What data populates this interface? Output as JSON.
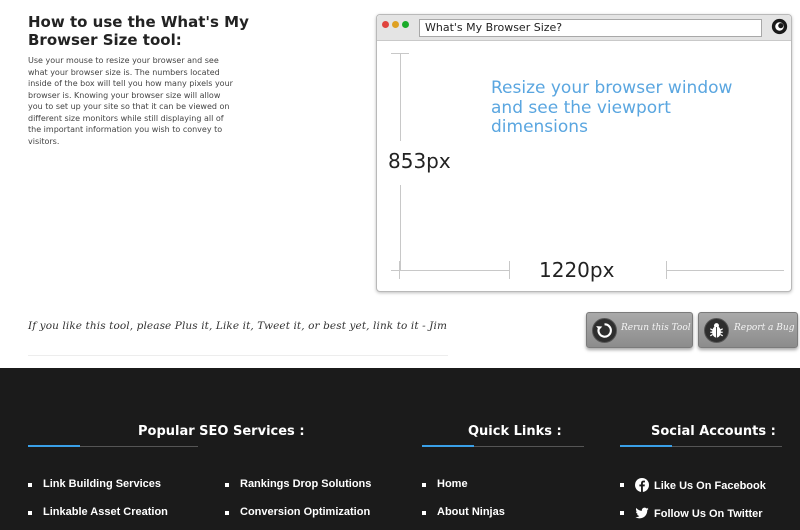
{
  "intro": {
    "title": "How to use the What's My Browser Size tool:",
    "body": "Use your mouse to resize your browser and see what your browser size is. The numbers located inside of the box will tell you how many pixels your browser is. Knowing your browser size will allow you to set up your site so that it can be viewed on different size monitors while still displaying all of the important information you wish to convey to visitors."
  },
  "browser_mock": {
    "url_bar_text": "What's My Browser Size?",
    "viewport_message": "Resize your browser window and see the viewport dimensions",
    "height_readout": "853px",
    "width_readout": "1220px"
  },
  "share": {
    "text": "If you like this tool, please Plus it, Like it, Tweet it, or best yet, link to it - Jim"
  },
  "buttons": {
    "rerun_label": "Rerun this Tool",
    "report_bug_label": "Report a Bug"
  },
  "footer": {
    "columns": [
      {
        "heading": "Popular SEO Services :",
        "items": [
          "Link Building Services",
          "Linkable Asset Creation"
        ],
        "items_col2": [
          "Rankings Drop Solutions",
          "Conversion Optimization"
        ]
      },
      {
        "heading": "Quick Links :",
        "items": [
          "Home",
          "About Ninjas"
        ]
      },
      {
        "heading": "Social Accounts :",
        "items": [
          "Like Us On Facebook",
          "Follow Us On Twitter"
        ]
      }
    ]
  },
  "colors": {
    "accent": "#3aa0e8",
    "viewport_text": "#5aa6e0",
    "footer_bg": "#1b1b1b"
  },
  "icons": {
    "browser_logo": "browser-logo-icon",
    "rerun": "refresh-icon",
    "report_bug": "bug-icon",
    "facebook": "facebook-icon",
    "twitter": "twitter-icon"
  }
}
